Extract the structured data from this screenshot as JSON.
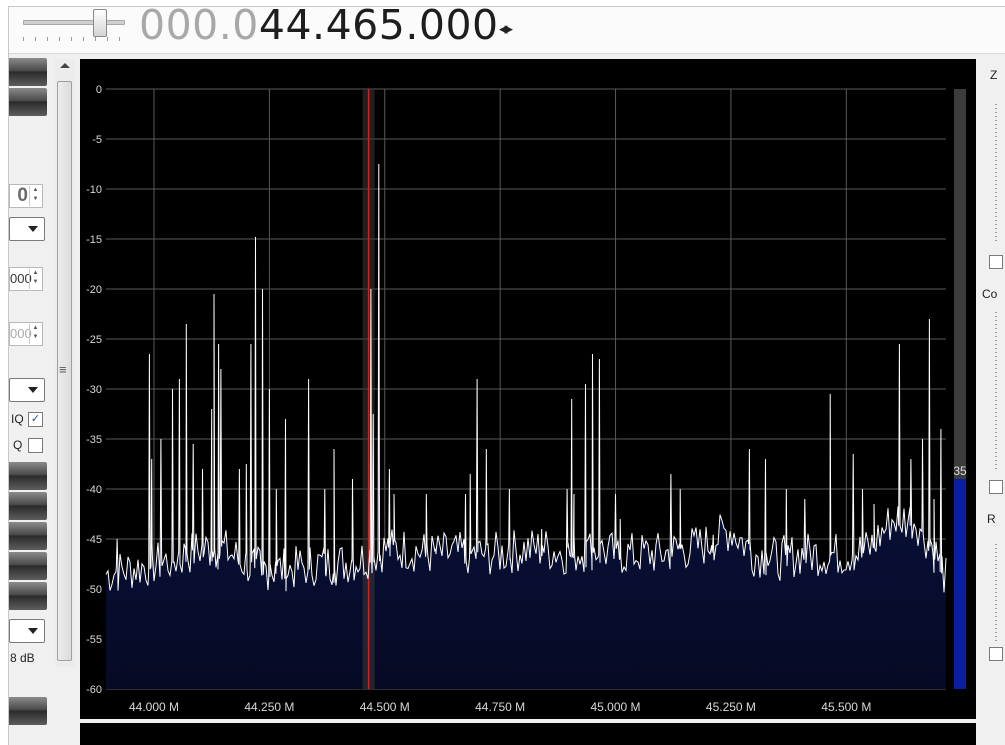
{
  "frequency": {
    "dim_digits": "000.0",
    "active_digits": "44.465.000",
    "arrows": "◂▸"
  },
  "left_panel": {
    "spin_value": "0",
    "spin_field_1": "000",
    "spin_field_2": "000",
    "checkbox_iq_label": "IQ",
    "checkbox_iq_checked": true,
    "checkbox_q_label": "Q",
    "checkbox_q_checked": false,
    "db_label": "8 dB"
  },
  "right_panel": {
    "label_z": "Z",
    "label_co": "Co",
    "label_r": "R",
    "level_value": "35"
  },
  "chart_data": {
    "type": "line",
    "title": "",
    "xlabel": "",
    "ylabel": "",
    "x_unit": "MHz",
    "xlim": [
      43.896,
      45.716
    ],
    "ylim": [
      -60,
      0
    ],
    "grid": true,
    "x_ticks": [
      "44.000 M",
      "44.250 M",
      "44.500 M",
      "44.750 M",
      "45.000 M",
      "45.250 M",
      "45.500 M"
    ],
    "x_tick_values": [
      44.0,
      44.25,
      44.5,
      44.75,
      45.0,
      45.25,
      45.5
    ],
    "y_ticks": [
      "0",
      "-5",
      "-10",
      "-15",
      "-20",
      "-25",
      "-30",
      "-35",
      "-40",
      "-45",
      "-50",
      "-55",
      "-60"
    ],
    "y_tick_values": [
      0,
      -5,
      -10,
      -15,
      -20,
      -25,
      -30,
      -35,
      -40,
      -45,
      -50,
      -55,
      -60
    ],
    "tuned_frequency": 44.465,
    "noise_floor": [
      [
        43.896,
        -48.5
      ],
      [
        43.95,
        -48.0
      ],
      [
        44.0,
        -47.5
      ],
      [
        44.05,
        -47.0
      ],
      [
        44.1,
        -46.0
      ],
      [
        44.15,
        -46.0
      ],
      [
        44.2,
        -47.5
      ],
      [
        44.25,
        -48.0
      ],
      [
        44.3,
        -48.0
      ],
      [
        44.35,
        -47.5
      ],
      [
        44.4,
        -47.5
      ],
      [
        44.45,
        -47.0
      ],
      [
        44.5,
        -46.0
      ],
      [
        44.55,
        -46.0
      ],
      [
        44.6,
        -46.5
      ],
      [
        44.65,
        -46.5
      ],
      [
        44.7,
        -46.5
      ],
      [
        44.75,
        -46.5
      ],
      [
        44.8,
        -46.0
      ],
      [
        44.85,
        -46.0
      ],
      [
        44.9,
        -46.5
      ],
      [
        44.95,
        -46.0
      ],
      [
        45.0,
        -46.5
      ],
      [
        45.05,
        -46.5
      ],
      [
        45.1,
        -46.5
      ],
      [
        45.15,
        -46.0
      ],
      [
        45.2,
        -45.5
      ],
      [
        45.25,
        -44.0
      ],
      [
        45.3,
        -46.5
      ],
      [
        45.35,
        -47.0
      ],
      [
        45.4,
        -46.5
      ],
      [
        45.45,
        -46.5
      ],
      [
        45.5,
        -46.5
      ],
      [
        45.55,
        -46.0
      ],
      [
        45.6,
        -43.0
      ],
      [
        45.65,
        -43.0
      ],
      [
        45.7,
        -47.0
      ],
      [
        45.716,
        -49.0
      ]
    ],
    "peaks": [
      [
        43.92,
        -45.0
      ],
      [
        43.99,
        -26.5
      ],
      [
        43.995,
        -37.0
      ],
      [
        44.015,
        -35.0
      ],
      [
        44.04,
        -30.0
      ],
      [
        44.055,
        -29.0
      ],
      [
        44.07,
        -23.5
      ],
      [
        44.085,
        -35.5
      ],
      [
        44.105,
        -38.0
      ],
      [
        44.125,
        -32.0
      ],
      [
        44.13,
        -20.5
      ],
      [
        44.14,
        -25.5
      ],
      [
        44.145,
        -28.0
      ],
      [
        44.185,
        -38.0
      ],
      [
        44.2,
        -37.5
      ],
      [
        44.21,
        -25.5
      ],
      [
        44.22,
        -14.8
      ],
      [
        44.235,
        -20.0
      ],
      [
        44.25,
        -30.0
      ],
      [
        44.265,
        -40.0
      ],
      [
        44.285,
        -33.0
      ],
      [
        44.335,
        -29.0
      ],
      [
        44.37,
        -40.0
      ],
      [
        44.39,
        -36.0
      ],
      [
        44.43,
        -39.0
      ],
      [
        44.47,
        -20.0
      ],
      [
        44.475,
        -32.5
      ],
      [
        44.487,
        -7.5
      ],
      [
        44.51,
        -38.0
      ],
      [
        44.52,
        -40.5
      ],
      [
        44.59,
        -40.5
      ],
      [
        44.61,
        -46.0
      ],
      [
        44.675,
        -40.5
      ],
      [
        44.685,
        -38.5
      ],
      [
        44.7,
        -29.0
      ],
      [
        44.72,
        -36.0
      ],
      [
        44.77,
        -40.0
      ],
      [
        44.84,
        -44.0
      ],
      [
        44.895,
        -40.0
      ],
      [
        44.905,
        -31.0
      ],
      [
        44.91,
        -40.5
      ],
      [
        44.935,
        -29.5
      ],
      [
        44.95,
        -26.5
      ],
      [
        44.965,
        -27.0
      ],
      [
        45.0,
        -40.5
      ],
      [
        45.01,
        -43.0
      ],
      [
        45.12,
        -38.5
      ],
      [
        45.14,
        -40.0
      ],
      [
        45.21,
        -46.0
      ],
      [
        45.29,
        -36.0
      ],
      [
        45.325,
        -37.0
      ],
      [
        45.37,
        -40.0
      ],
      [
        45.41,
        -41.0
      ],
      [
        45.465,
        -30.5
      ],
      [
        45.515,
        -36.5
      ],
      [
        45.535,
        -40.0
      ],
      [
        45.56,
        -41.5
      ],
      [
        45.615,
        -25.5
      ],
      [
        45.64,
        -37.0
      ],
      [
        45.665,
        -35.0
      ],
      [
        45.68,
        -23.0
      ],
      [
        45.69,
        -41.0
      ],
      [
        45.705,
        -34.0
      ]
    ]
  },
  "colors": {
    "plot_background": "#000000",
    "trace": "#ffffff",
    "fill": "#0b1a5c",
    "grid": "#5a5a5a",
    "tuned_marker": "#d02020",
    "level_bar": "#0a1fa0"
  }
}
